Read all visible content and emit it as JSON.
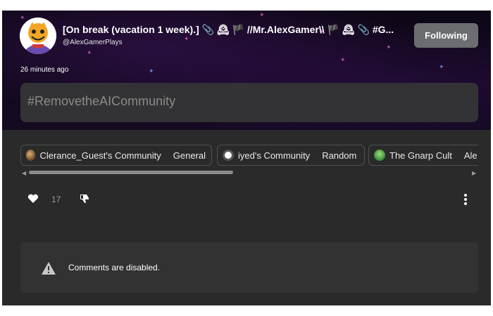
{
  "post": {
    "title": "[On break (vacation 1 week).] 📎 🕰 🏴 //Mr.AlexGamer\\\\ 🏴 🕰 📎 #G...",
    "handle": "@AlexGamerPlays",
    "timestamp": "26 minutes ago",
    "follow_label": "Following",
    "body_text": "#RemovetheAICommunity"
  },
  "communities": [
    {
      "name": "Clerance_Guest's Community",
      "channel": "General"
    },
    {
      "name": "iyed's Community",
      "channel": "Random"
    },
    {
      "name": "The Gnarp Cult",
      "channel": "Ale"
    }
  ],
  "actions": {
    "like_count": "17",
    "icons": [
      "heart-icon",
      "dislike-icon",
      "more-vertical-icon"
    ]
  },
  "comments": {
    "disabled_text": "Comments are disabled.",
    "icon": "warning-icon"
  },
  "colors": {
    "banner": "#140a22",
    "follow_button": "#6b6d70",
    "panel": "#2a2a2a",
    "post_body": "#333335"
  }
}
